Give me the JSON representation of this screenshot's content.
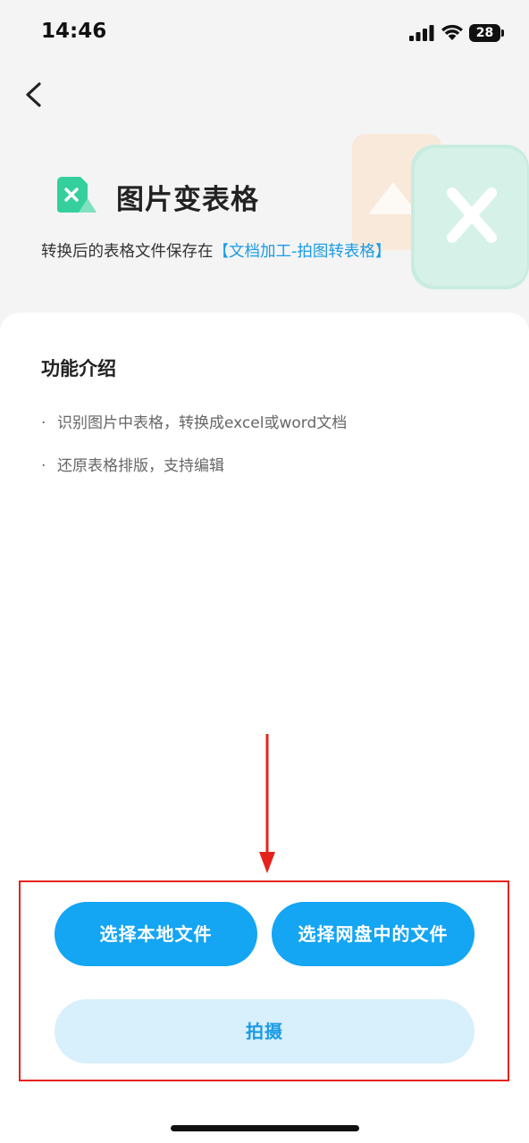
{
  "status_bar": {
    "time": "14:46",
    "battery": "28",
    "icons": [
      "signal-icon",
      "wifi-icon",
      "battery-icon"
    ]
  },
  "nav": {
    "back_icon": "chevron-left-icon"
  },
  "header": {
    "title": "图片变表格",
    "save_prefix": "转换后的表格文件保存在",
    "save_link": "【文档加工-拍图转表格】",
    "logo_icon": "excel-image-icon",
    "colors": {
      "accent": "#1a9be6",
      "logo_green": "#34cf9d"
    }
  },
  "intro": {
    "title": "功能介绍",
    "features": [
      "识别图片中表格，转换成excel或word文档",
      "还原表格排版，支持编辑"
    ],
    "bullet": "·"
  },
  "actions": {
    "local_file": "选择本地文件",
    "cloud_file": "选择网盘中的文件",
    "shoot": "拍摄",
    "colors": {
      "primary": "#14a5f3",
      "secondary_bg": "#d8effc",
      "annotation": "#e5221b"
    }
  }
}
